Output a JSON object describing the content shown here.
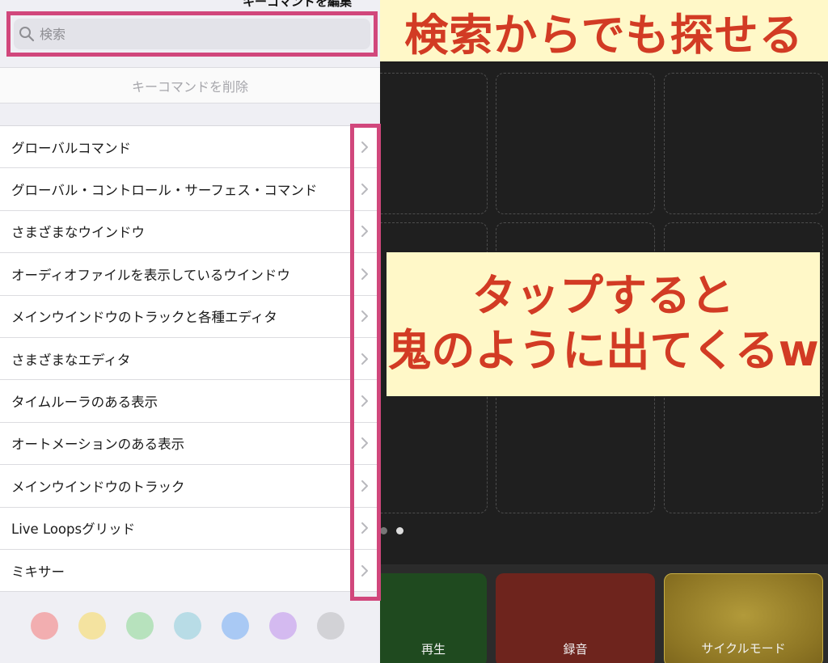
{
  "panel": {
    "title": "キーコマンドを編集",
    "search": {
      "placeholder": "検索"
    },
    "delete_label": "キーコマンドを削除",
    "categories": [
      {
        "label": "グローバルコマンド"
      },
      {
        "label": "グローバル・コントロール・サーフェス・コマンド"
      },
      {
        "label": "さまざまなウインドウ"
      },
      {
        "label": "オーディオファイルを表示しているウインドウ"
      },
      {
        "label": "メインウインドウのトラックと各種エディタ"
      },
      {
        "label": "さまざまなエディタ"
      },
      {
        "label": "タイムルーラのある表示"
      },
      {
        "label": "オートメーションのある表示"
      },
      {
        "label": "メインウインドウのトラック"
      },
      {
        "label": "Live Loopsグリッド"
      },
      {
        "label": "ミキサー"
      }
    ],
    "color_swatches": [
      "#f2aeb0",
      "#f4e3a0",
      "#b7e2bd",
      "#b8dce6",
      "#a9c9f4",
      "#d4baf0",
      "#d2d2d6"
    ]
  },
  "transport": {
    "play_label": "再生",
    "record_label": "録音",
    "cycle_label": "サイクルモード"
  },
  "annotations": {
    "top": "検索からでも探せる",
    "middle_line1": "タップすると",
    "middle_line2": "鬼のように出てくるw"
  },
  "colors": {
    "highlight": "#d1477c",
    "annotation_text": "#d23b24",
    "annotation_bg": "#fff8c8"
  }
}
